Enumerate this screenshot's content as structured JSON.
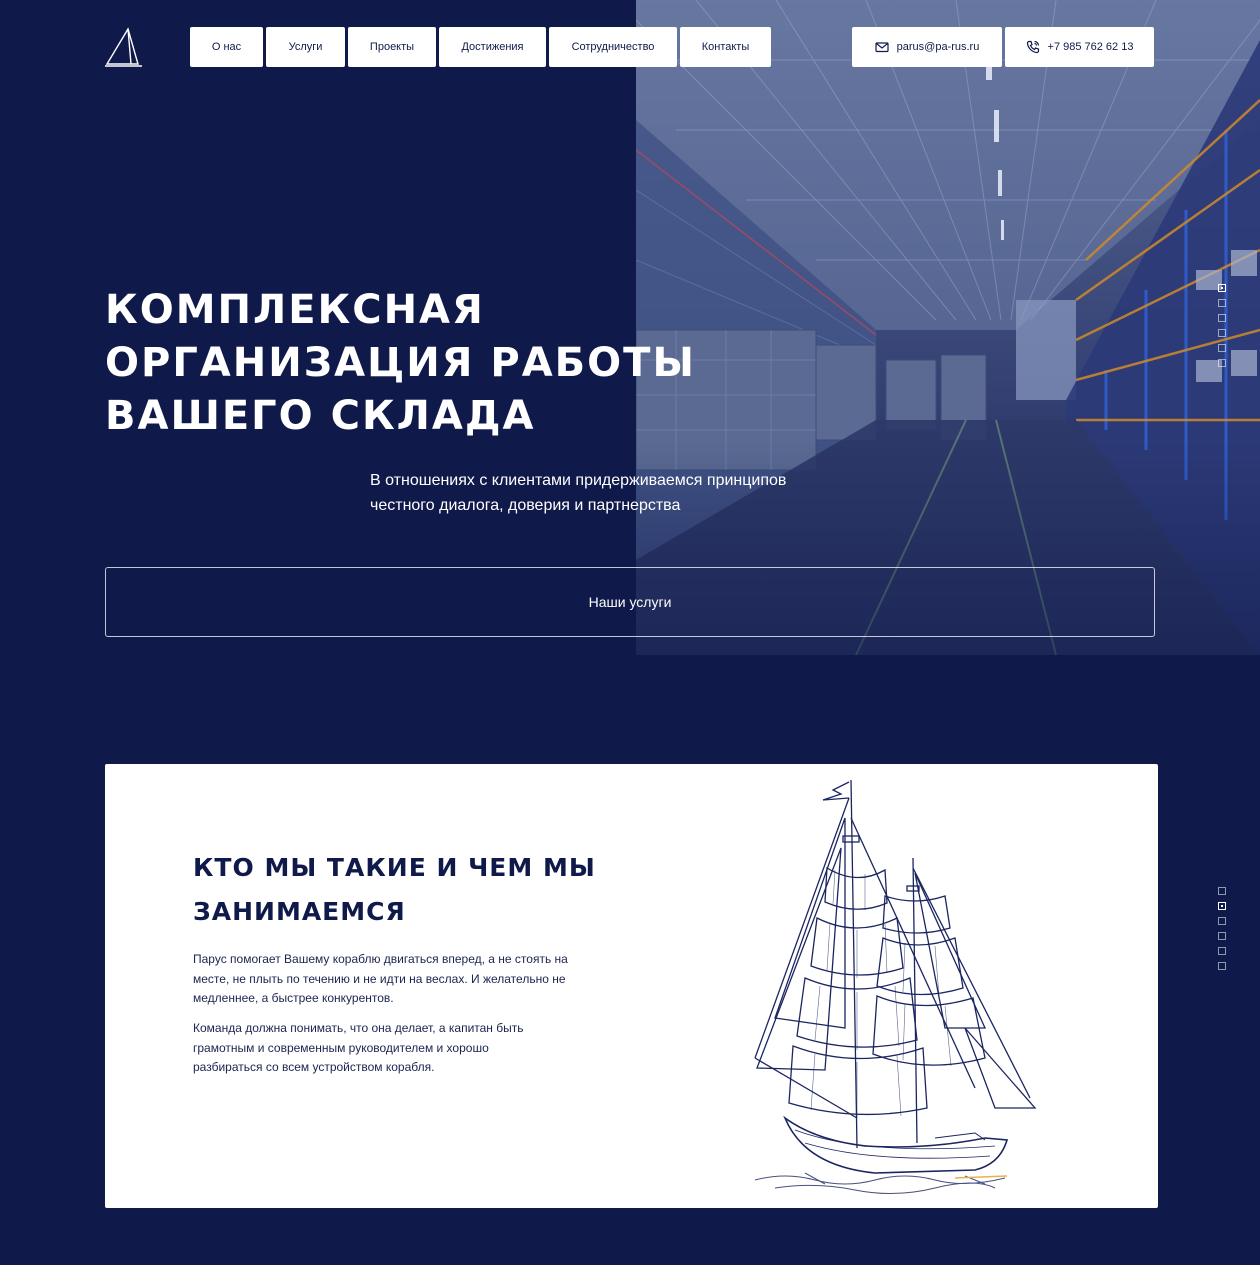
{
  "header": {
    "nav": [
      "О нас",
      "Услуги",
      "Проекты",
      "Достижения",
      "Сотрудничество",
      "Контакты"
    ],
    "email": "parus@pa-rus.ru",
    "phone": "+7 985 762 62 13",
    "email_icon": "mail-icon",
    "phone_icon": "phone-icon",
    "logo_icon": "sail-logo-icon"
  },
  "hero": {
    "title": "КОМПЛЕКСНАЯ ОРГАНИЗАЦИЯ РАБОТЫ ВАШЕГО СКЛАДА",
    "subtitle": "В отношениях с клиентами придерживаемся принципов честного диалога, доверия и партнерства",
    "cta_label": "Наши услуги",
    "pager_active": 1,
    "pager_count": 6
  },
  "about": {
    "title": "КТО МЫ ТАКИЕ И ЧЕМ МЫ ЗАНИМАЕМСЯ",
    "paragraphs": [
      "Парус помогает Вашему кораблю двигаться вперед, а не стоять на месте, не плыть по течению и не идти на веслах. И желательно не медленнее, а быстрее конкурентов.",
      "Команда должна понимать, что она делает, а капитан быть грамотным и современным руководителем и хорошо разбираться со всем устройством корабля."
    ],
    "pager_active": 2,
    "pager_count": 6
  },
  "colors": {
    "navy": "#101a4a",
    "white": "#ffffff"
  }
}
